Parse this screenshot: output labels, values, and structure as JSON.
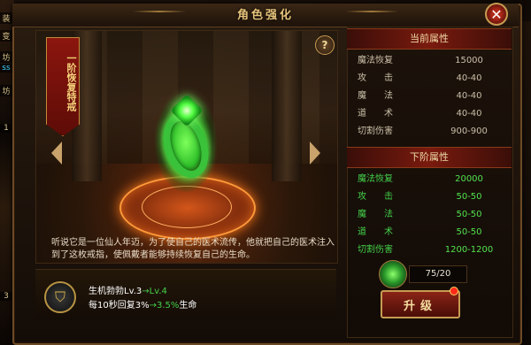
{
  "window": {
    "title": "角色强化"
  },
  "left_edge": {
    "items": [
      "装",
      "变",
      "坊",
      "ss",
      "坊",
      "1",
      "3"
    ]
  },
  "stage": {
    "banner_text": "一阶恢复特戒",
    "description": "听说它是一位仙人年迈，为了使自己的医术流传，他就把自己的医术注入到了这枚戒指，使佩戴者能够持续恢复自己的生命。"
  },
  "skill": {
    "name": "生机勃勃Lv.3",
    "arrow": "→",
    "next_level": "Lv.4",
    "effect_prefix": "每10秒回复3%",
    "effect_arrow": "→",
    "effect_next": "3.5%",
    "effect_suffix": "生命"
  },
  "current_stats": {
    "header": "当前属性",
    "rows": [
      {
        "label": "魔法恢复",
        "value": "15000"
      },
      {
        "label": "攻　　击",
        "value": "40-40"
      },
      {
        "label": "魔　　法",
        "value": "40-40"
      },
      {
        "label": "道　　术",
        "value": "40-40"
      },
      {
        "label": "切割伤害",
        "value": "900-900"
      }
    ]
  },
  "next_stats": {
    "header": "下阶属性",
    "rows": [
      {
        "label": "魔法恢复",
        "value": "20000"
      },
      {
        "label": "攻　　击",
        "value": "50-50"
      },
      {
        "label": "魔　　法",
        "value": "50-50"
      },
      {
        "label": "道　　术",
        "value": "50-50"
      },
      {
        "label": "切割伤害",
        "value": "1200-1200"
      }
    ]
  },
  "material": {
    "count": "75/20"
  },
  "buttons": {
    "upgrade": "升级",
    "close": "✕",
    "help": "?"
  },
  "colors": {
    "accent_green": "#43d04a",
    "header_red": "#7a1a0e",
    "gold": "#c79b52"
  }
}
